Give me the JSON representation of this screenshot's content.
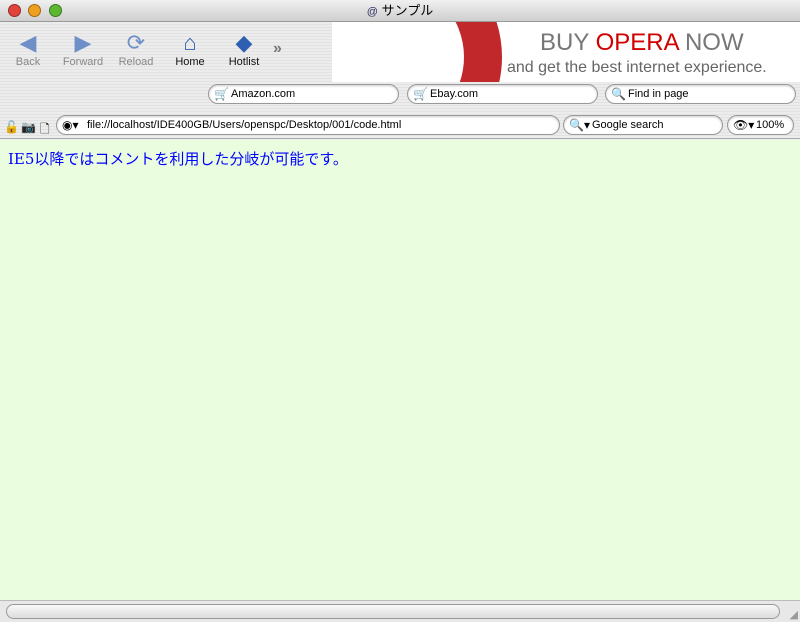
{
  "window": {
    "title": "サンプル"
  },
  "toolbar": {
    "back": "Back",
    "forward": "Forward",
    "reload": "Reload",
    "home": "Home",
    "hotlist": "Hotlist",
    "more": "»"
  },
  "banner": {
    "buy": "BUY ",
    "opera": "OPERA",
    "now": " NOW",
    "tagline": "and get the best internet experience."
  },
  "quick_search": [
    "Amazon.com",
    "Ebay.com",
    "Find in page"
  ],
  "address": {
    "url": "file://localhost/IDE400GB/Users/openspc/Desktop/001/code.html"
  },
  "search": {
    "engine": "Google search"
  },
  "zoom": {
    "level": "100%"
  },
  "page": {
    "text": "IE5以降ではコメントを利用した分岐が可能です。"
  }
}
